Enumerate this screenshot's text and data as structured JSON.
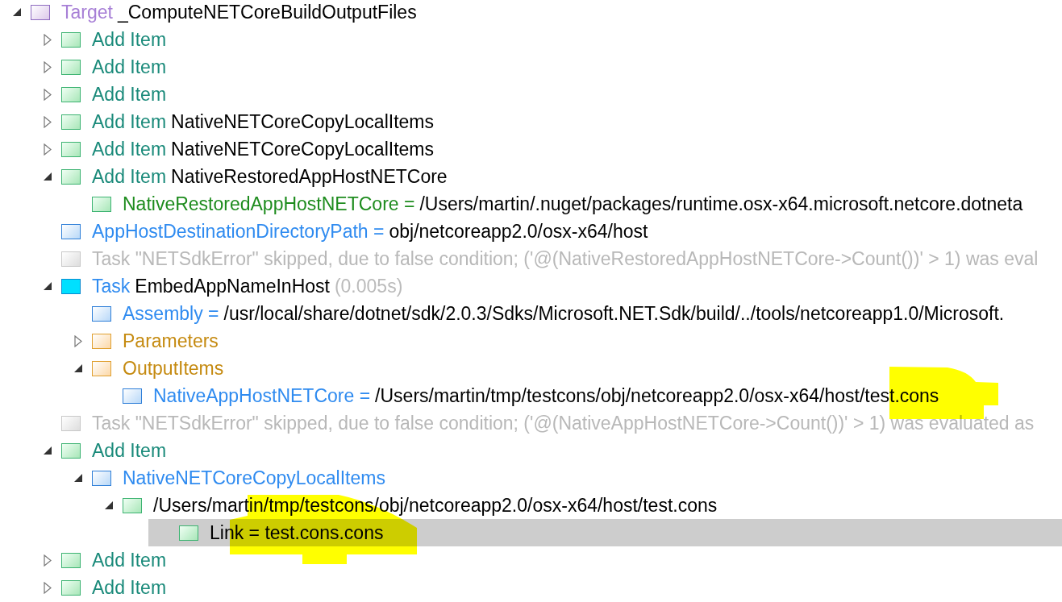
{
  "tree": [
    {
      "kind": "target",
      "keyword": "Target",
      "text": "_ComputeNETCoreBuildOutputFiles",
      "expanded": true,
      "selected": false,
      "children": [
        {
          "kind": "add-item",
          "keyword": "Add Item",
          "expanded": false,
          "selected": false
        },
        {
          "kind": "add-item",
          "keyword": "Add Item",
          "expanded": false,
          "selected": false
        },
        {
          "kind": "add-item",
          "keyword": "Add Item",
          "expanded": false,
          "selected": false
        },
        {
          "kind": "add-item",
          "keyword": "Add Item",
          "text": "NativeNETCoreCopyLocalItems",
          "expanded": false,
          "selected": false
        },
        {
          "kind": "add-item",
          "keyword": "Add Item",
          "text": "NativeNETCoreCopyLocalItems",
          "expanded": false,
          "selected": false
        },
        {
          "kind": "add-item",
          "keyword": "Add Item",
          "text": "NativeRestoredAppHostNETCore",
          "expanded": true,
          "selected": false,
          "children": [
            {
              "kind": "item",
              "keyword": "NativeRestoredAppHostNETCore =",
              "text": "/Users/martin/.nuget/packages/runtime.osx-x64.microsoft.netcore.dotneta",
              "selected": false
            }
          ]
        },
        {
          "kind": "property",
          "keyword": "AppHostDestinationDirectoryPath =",
          "text": "obj/netcoreapp2.0/osx-x64/host",
          "selected": false
        },
        {
          "kind": "message",
          "keyword": "Task \"NETSdkError\" skipped, due to false condition; ('@(NativeRestoredAppHostNETCore->Count())' > 1) was eval",
          "selected": false
        },
        {
          "kind": "task",
          "keyword": "Task",
          "text": "EmbedAppNameInHost",
          "duration": "(0.005s)",
          "expanded": true,
          "selected": false,
          "children": [
            {
              "kind": "property",
              "keyword": "Assembly =",
              "text": "/usr/local/share/dotnet/sdk/2.0.3/Sdks/Microsoft.NET.Sdk/build/../tools/netcoreapp1.0/Microsoft.",
              "selected": false
            },
            {
              "kind": "folder",
              "keyword": "Parameters",
              "expanded": false,
              "selected": false
            },
            {
              "kind": "folder",
              "keyword": "OutputItems",
              "expanded": true,
              "selected": false,
              "children": [
                {
                  "kind": "property",
                  "keyword": "NativeAppHostNETCore =",
                  "text": "/Users/martin/tmp/testcons/obj/netcoreapp2.0/osx-x64/host/test.cons",
                  "selected": false
                }
              ]
            }
          ]
        },
        {
          "kind": "message",
          "keyword": "Task \"NETSdkError\" skipped, due to false condition; ('@(NativeAppHostNETCore->Count())' > 1) was evaluated as",
          "selected": false
        },
        {
          "kind": "add-item",
          "keyword": "Add Item",
          "expanded": true,
          "selected": false,
          "children": [
            {
              "kind": "property",
              "keyword": "NativeNETCoreCopyLocalItems",
              "expanded": true,
              "selected": false,
              "children": [
                {
                  "kind": "item",
                  "text": "/Users/martin/tmp/testcons/obj/netcoreapp2.0/osx-x64/host/test.cons",
                  "expanded": true,
                  "selected": false,
                  "children": [
                    {
                      "kind": "item",
                      "text": "Link = test.cons.cons",
                      "selected": true
                    }
                  ]
                }
              ]
            }
          ]
        },
        {
          "kind": "add-item",
          "keyword": "Add Item",
          "expanded": false,
          "selected": false
        },
        {
          "kind": "add-item",
          "keyword": "Add Item",
          "expanded": false,
          "selected": false
        }
      ]
    }
  ]
}
